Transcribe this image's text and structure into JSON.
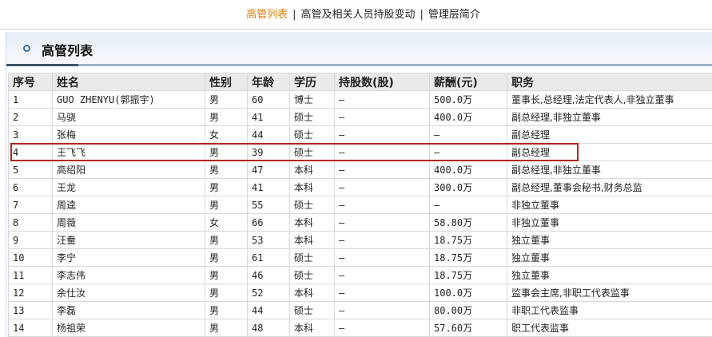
{
  "nav": {
    "items": [
      "高管列表",
      "高管及相关人员持股变动",
      "管理层简介"
    ],
    "separator": "|"
  },
  "section": {
    "title": "高管列表"
  },
  "table": {
    "headers": [
      "序号",
      "姓名",
      "性别",
      "年龄",
      "学历",
      "持股数(股)",
      "薪酬(元)",
      "职务"
    ],
    "rows": [
      [
        "1",
        "GUO ZHENYU(郭振宇)",
        "男",
        "60",
        "博士",
        "—",
        "500.0万",
        "董事长,总经理,法定代表人,非独立董事"
      ],
      [
        "2",
        "马骁",
        "男",
        "41",
        "硕士",
        "—",
        "400.0万",
        "副总经理,非独立董事"
      ],
      [
        "3",
        "张梅",
        "女",
        "44",
        "硕士",
        "—",
        "—",
        "副总经理"
      ],
      [
        "4",
        "王飞飞",
        "男",
        "39",
        "硕士",
        "—",
        "—",
        "副总经理"
      ],
      [
        "5",
        "高绍阳",
        "男",
        "47",
        "本科",
        "—",
        "400.0万",
        "副总经理,非独立董事"
      ],
      [
        "6",
        "王龙",
        "男",
        "41",
        "本科",
        "—",
        "300.0万",
        "副总经理,董事会秘书,财务总监"
      ],
      [
        "7",
        "周逵",
        "男",
        "55",
        "硕士",
        "—",
        "—",
        "非独立董事"
      ],
      [
        "8",
        "周薇",
        "女",
        "66",
        "本科",
        "—",
        "58.80万",
        "非独立董事"
      ],
      [
        "9",
        "汪鲞",
        "男",
        "53",
        "本科",
        "—",
        "18.75万",
        "独立董事"
      ],
      [
        "10",
        "李宁",
        "男",
        "61",
        "硕士",
        "—",
        "18.75万",
        "独立董事"
      ],
      [
        "11",
        "李志伟",
        "男",
        "46",
        "硕士",
        "—",
        "18.75万",
        "独立董事"
      ],
      [
        "12",
        "余仕汝",
        "男",
        "52",
        "本科",
        "—",
        "100.0万",
        "监事会主席,非职工代表监事"
      ],
      [
        "13",
        "李磊",
        "男",
        "44",
        "硕士",
        "—",
        "80.00万",
        "非职工代表监事"
      ],
      [
        "14",
        "杨祖荣",
        "男",
        "48",
        "本科",
        "—",
        "57.60万",
        "职工代表监事"
      ]
    ],
    "highlighted_row": 4
  },
  "colors": {
    "active_nav": "#e07b00",
    "highlight": "#b2261c"
  }
}
